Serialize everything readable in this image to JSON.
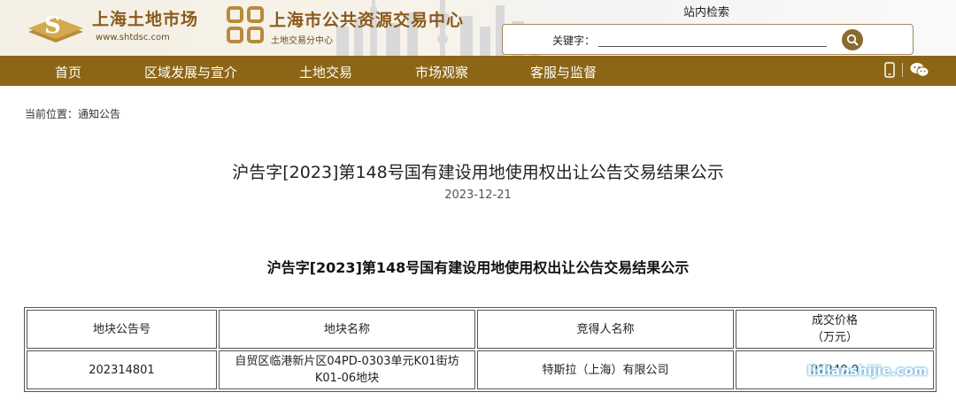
{
  "header": {
    "brand1_name": "上海土地市场",
    "brand1_url": "www.shtdsc.com",
    "brand2_name": "上海市公共资源交易中心",
    "brand2_sub": "土地交易分中心",
    "search_title": "站内检索",
    "keyword_label": "关键字：",
    "keyword_value": ""
  },
  "nav": {
    "items": [
      "首页",
      "区域发展与宣介",
      "土地交易",
      "市场观察",
      "客服与监督"
    ]
  },
  "breadcrumb": {
    "prefix": "当前位置：",
    "current": "通知公告"
  },
  "article": {
    "title": "沪告字[2023]第148号国有建设用地使用权出让公告交易结果公示",
    "date": "2023-12-21",
    "content_title": "沪告字[2023]第148号国有建设用地使用权出让公告交易结果公示"
  },
  "table": {
    "headers": [
      "地块公告号",
      "地块名称",
      "竞得人名称",
      "成交价格",
      "（万元）"
    ],
    "rows": [
      {
        "notice_no": "202314801",
        "plot_name_line1": "自贸区临港新片区04PD-0303单元K01街坊",
        "plot_name_line2": "K01-06地块",
        "winner": "特斯拉（上海）有限公司",
        "price": "22240.0"
      }
    ]
  },
  "watermark": "lidianshijie.com",
  "colors": {
    "nav_bg": "#8c6516",
    "brand_gold": "#8a5a1c",
    "search_button": "#8a6a2e"
  },
  "icons": [
    "search-icon",
    "mobile-icon",
    "wechat-icon"
  ]
}
